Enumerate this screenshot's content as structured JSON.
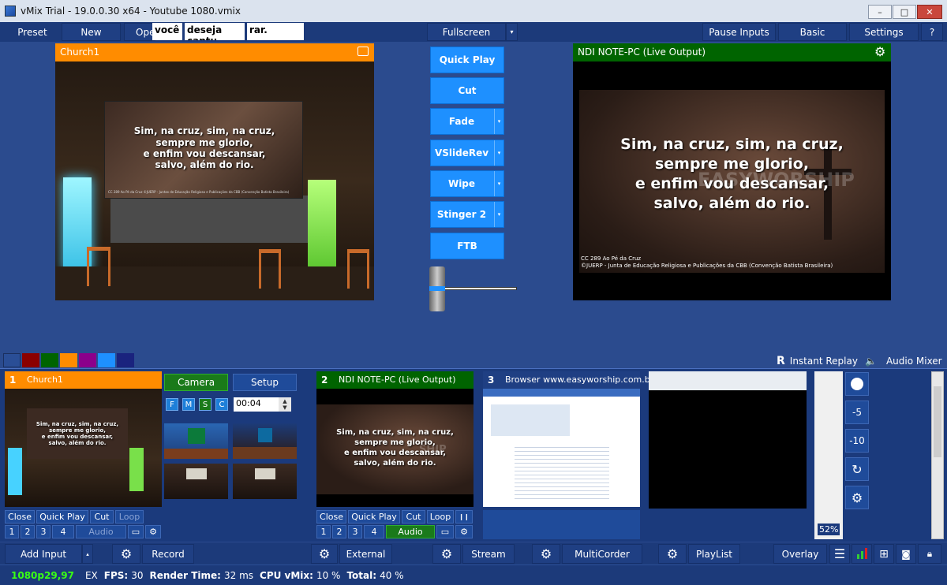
{
  "window": {
    "title": "vMix Trial - 19.0.0.30 x64 - Youtube 1080.vmix",
    "controls": [
      "–",
      "□",
      "✕"
    ]
  },
  "topbar": {
    "preset": "Preset",
    "new": "New",
    "open": "Ope",
    "overlay_words": [
      "você",
      "deseja captu",
      "rar."
    ],
    "fullscreen": "Fullscreen",
    "pause_inputs": "Pause Inputs",
    "basic": "Basic",
    "settings": "Settings",
    "help": "?"
  },
  "preview": {
    "title": "Church1",
    "lyrics": [
      "Sim, na cruz, sim, na cruz,",
      "sempre me glorio,",
      "e enfim vou descansar,",
      "salvo, além do rio."
    ],
    "credit": "CC 289 Ao Pé da Cruz  ©JUERP - Juntas de Educação Religiosa e Publicações da CBB (Convenção Batista Brasileira)"
  },
  "transitions": {
    "quick_play": "Quick Play",
    "cut": "Cut",
    "fade": "Fade",
    "vsliderev": "VSlideRev",
    "wipe": "Wipe",
    "stinger2": "Stinger 2",
    "ftb": "FTB"
  },
  "output": {
    "title": "NDI NOTE-PC (Live Output)",
    "watermark": "EASYWORSHIP",
    "credit_line1": "CC 289 Ao Pé da Cruz",
    "credit_line2": "©JUERP - Junta de Educação Religiosa e Publicações da CBB (Convenção Batista Brasileira)"
  },
  "colors": {
    "tags": [
      "#2a4e96",
      "#8b0000",
      "#006400",
      "#ff8c00",
      "#8b008b",
      "#1e90ff",
      "#1a237e"
    ],
    "accent_orange": "#ff8c00",
    "live_green": "#006400",
    "button_blue": "#1e90ff"
  },
  "right_links": {
    "instant_replay": "Instant Replay",
    "audio_mixer": "Audio Mixer"
  },
  "input1": {
    "number": "1",
    "title": "Church1",
    "camera": "Camera",
    "setup": "Setup",
    "fmsc": [
      "F",
      "M",
      "S",
      "C"
    ],
    "time": "00:04",
    "close": "Close",
    "quick_play": "Quick Play",
    "cut": "Cut",
    "loop": "Loop",
    "nums": [
      "1",
      "2",
      "3",
      "4"
    ],
    "audio": "Audio"
  },
  "input2": {
    "number": "2",
    "title": "NDI NOTE-PC (Live Output)",
    "watermark": "SHIP",
    "close": "Close",
    "quick_play": "Quick Play",
    "cut": "Cut",
    "loop": "Loop",
    "pause": "❙❙",
    "nums": [
      "1",
      "2",
      "3",
      "4"
    ],
    "audio": "Audio"
  },
  "input3": {
    "number": "3",
    "title": "Browser www.easyworship.com.br"
  },
  "replay": {
    "minus5": "-5",
    "minus10": "-10",
    "zoom": "52%"
  },
  "bottombar": {
    "add_input": "Add Input",
    "record": "Record",
    "external": "External",
    "stream": "Stream",
    "multicorder": "MultiCorder",
    "playlist": "PlayList",
    "overlay": "Overlay"
  },
  "status": {
    "format": "1080p29,97",
    "ex": "EX",
    "fps_label": "FPS:",
    "fps": "30",
    "render_label": "Render Time:",
    "render": "32 ms",
    "cpu_label": "CPU vMix:",
    "cpu": "10 %",
    "total_label": "Total:",
    "total": "40 %"
  }
}
